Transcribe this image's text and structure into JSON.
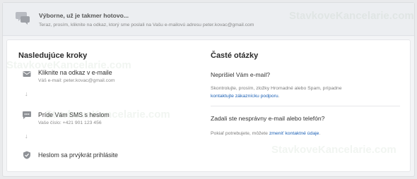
{
  "banner": {
    "title": "Výborne, už je takmer hotovo...",
    "subtitle": "Teraz, prosím, kliknite na odkaz, ktorý sme poslali na Vašu e-mailovú adresu peter.kovac@gmail.com",
    "icon": "chat-bubbles-icon"
  },
  "steps": {
    "heading": "Nasledujúce kroky",
    "items": [
      {
        "title": "Kliknite na odkaz v e-maile",
        "sub": "Váš e-mail: peter.kovac@gmail.com",
        "icon": "mail-icon"
      },
      {
        "title": "Príde Vám SMS s heslom",
        "sub": "Vaše číslo: +421 901 123 456",
        "icon": "sms-icon"
      },
      {
        "title": "Heslom sa prvýkrát prihlásite",
        "sub": "",
        "icon": "shield-check-icon"
      }
    ],
    "arrow_symbol": "↓"
  },
  "faq": {
    "heading": "Časté otázky",
    "q1": {
      "question": "Neprišiel Vám e-mail?",
      "answer_text": "Skontrolujte, prosím, zložky Hromadné alebo Spam, prípadne",
      "answer_link": "kontaktujte zákaznícku podporu",
      "answer_end": "."
    },
    "q2": {
      "question": "Zadali ste nesprávny e-mail alebo telefón?",
      "answer_text": "Pokiaľ potrebujete, môžete",
      "answer_link": "zmeniť kontaktné údaje",
      "answer_end": "."
    }
  },
  "watermark": "StavkoveKancelarie.com",
  "colors": {
    "link": "#1a5fb4",
    "icon": "#8e9196"
  }
}
